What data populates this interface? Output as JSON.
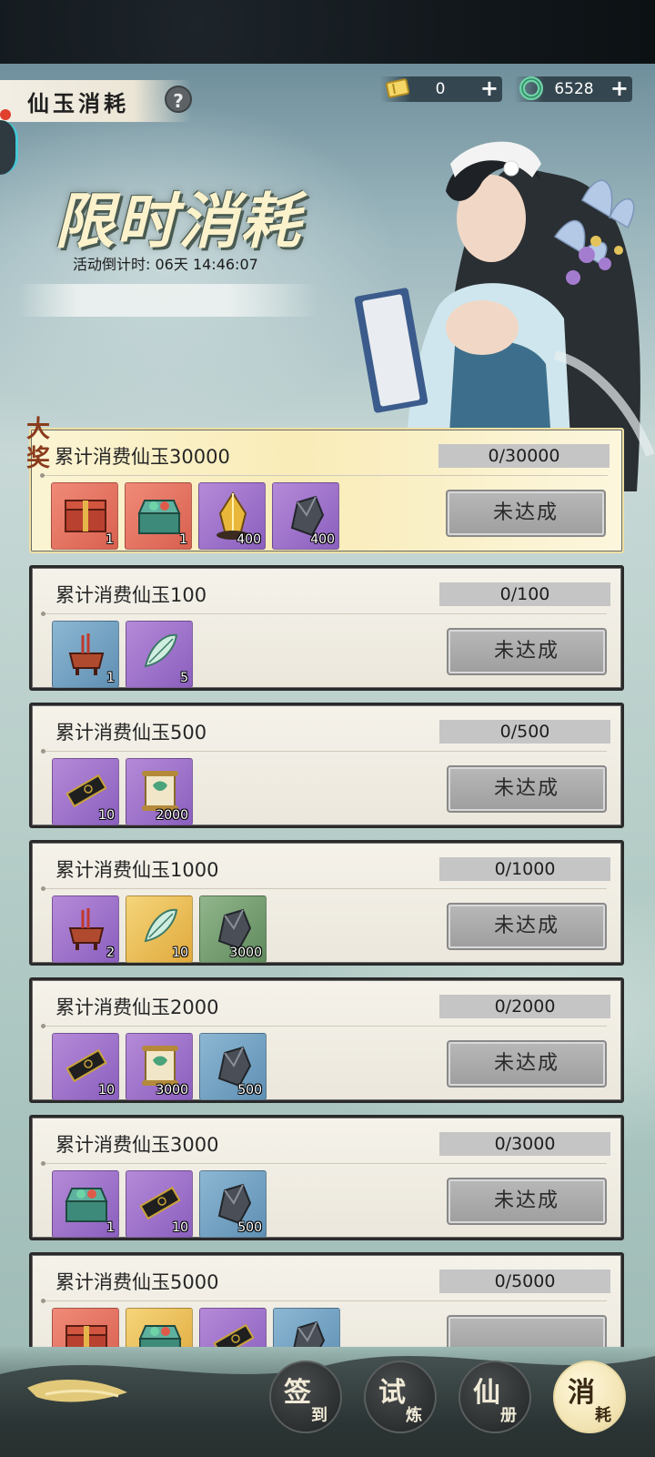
{
  "header": {
    "title": "仙玉消耗",
    "help_label": "?",
    "currencies": [
      {
        "icon": "ticket-icon",
        "value": "0",
        "plus": "+"
      },
      {
        "icon": "jade-icon",
        "value": "6528",
        "plus": "+"
      }
    ]
  },
  "event": {
    "title": "限时消耗",
    "countdown_label": "活动倒计时:",
    "countdown_value": "06天 14:46:07"
  },
  "grand_badge": "大奖",
  "rewards": [
    {
      "title": "累计消费仙玉30000",
      "progress": "0/30000",
      "button": "未达成",
      "items": [
        {
          "icon": "treasure-box-icon",
          "quality": "red",
          "qty": "1"
        },
        {
          "icon": "gift-chest-icon",
          "quality": "red",
          "qty": "1"
        },
        {
          "icon": "gold-crystal-icon",
          "quality": "purple",
          "qty": "400"
        },
        {
          "icon": "ore-icon",
          "quality": "purple",
          "qty": "400"
        }
      ]
    },
    {
      "title": "累计消费仙玉100",
      "progress": "0/100",
      "button": "未达成",
      "items": [
        {
          "icon": "incense-burner-icon",
          "quality": "blue",
          "qty": "1"
        },
        {
          "icon": "cicada-icon",
          "quality": "purple",
          "qty": "5"
        }
      ]
    },
    {
      "title": "累计消费仙玉500",
      "progress": "0/500",
      "button": "未达成",
      "items": [
        {
          "icon": "ink-stick-icon",
          "quality": "purple",
          "qty": "10"
        },
        {
          "icon": "scroll-icon",
          "quality": "purple",
          "qty": "2000"
        }
      ]
    },
    {
      "title": "累计消费仙玉1000",
      "progress": "0/1000",
      "button": "未达成",
      "items": [
        {
          "icon": "incense-burner-icon",
          "quality": "purple",
          "qty": "2"
        },
        {
          "icon": "cicada-icon",
          "quality": "gold",
          "qty": "10"
        },
        {
          "icon": "ore-icon",
          "quality": "green",
          "qty": "3000"
        }
      ]
    },
    {
      "title": "累计消费仙玉2000",
      "progress": "0/2000",
      "button": "未达成",
      "items": [
        {
          "icon": "ink-stick-icon",
          "quality": "purple",
          "qty": "10"
        },
        {
          "icon": "scroll-icon",
          "quality": "purple",
          "qty": "3000"
        },
        {
          "icon": "ore-icon",
          "quality": "blue",
          "qty": "500"
        }
      ]
    },
    {
      "title": "累计消费仙玉3000",
      "progress": "0/3000",
      "button": "未达成",
      "items": [
        {
          "icon": "gift-chest-icon",
          "quality": "purple",
          "qty": "1"
        },
        {
          "icon": "ink-stick-icon",
          "quality": "purple",
          "qty": "10"
        },
        {
          "icon": "ore-icon",
          "quality": "blue",
          "qty": "500"
        }
      ]
    },
    {
      "title": "累计消费仙玉5000",
      "progress": "0/5000",
      "button": "",
      "items": [
        {
          "icon": "treasure-box-icon",
          "quality": "red",
          "qty": ""
        },
        {
          "icon": "gift-chest-icon",
          "quality": "gold",
          "qty": ""
        },
        {
          "icon": "ink-stick-icon",
          "quality": "purple",
          "qty": ""
        },
        {
          "icon": "ore-icon",
          "quality": "blue",
          "qty": ""
        }
      ]
    }
  ],
  "nav": [
    {
      "big": "签",
      "small": "到",
      "active": false
    },
    {
      "big": "试",
      "small": "炼",
      "active": false
    },
    {
      "big": "仙",
      "small": "册",
      "active": false
    },
    {
      "big": "消",
      "small": "耗",
      "active": true
    }
  ]
}
